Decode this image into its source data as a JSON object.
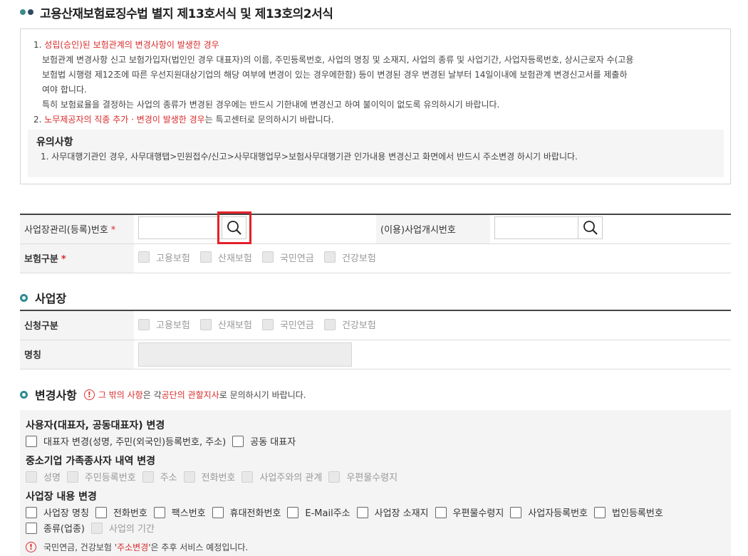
{
  "page": {
    "title": "고용산재보험료징수법 별지 제13호서식 및 제13호의2서식"
  },
  "notice": {
    "item1_num": "1.",
    "item1_head": "성립(승인)된 보험관계의 변경사항이 발생한 경우",
    "item1_line1": "보험관계 변경사항 신고 보험가입자(법인인 경우 대표자)의 이름, 주민등록번호, 사업의 명칭 및 소재지, 사업의 종류 및 사업기간, 사업자등록번호, 상시근로자 수(고용",
    "item1_line2": "보험법 시행령 제12조에 따른 우선지원대상기업의 해당 여부에 변경이 있는 경우에한함) 등이 변경된 경우 변경된 날부터 14일이내에 보험관계 변경신고서를 제출하",
    "item1_line3": "여야 합니다.",
    "item1_line4": "특히 보험료율을 결정하는 사업의 종류가 변경된 경우에는 반드시 기한내에 변경신고 하여 불이익이 없도록 유의하시기 바랍니다.",
    "item2_num": "2.",
    "item2_red": "노무제공자의 직종 추가 · 변경이 발생한 경우",
    "item2_rest": "는 특고센터로 문의하시기 바랍니다.",
    "caution_title": "유의사항",
    "caution_text": "1. 사무대행기관인 경우, 사무대행탭>민원접수/신고>사무대행업무>보험사무대행기관 인가내용 변경신고 화면에서 반드시 주소변경 하시기 바랍니다."
  },
  "form": {
    "reg_no_label": "사업장관리(등록)번호",
    "reg_no_required": "*",
    "reg_no_value": "",
    "start_no_label": "(이용)사업개시번호",
    "start_no_value": "",
    "insurance_label": "보험구분",
    "insurance_required": "*",
    "insurance_options": [
      "고용보험",
      "산재보험",
      "국민연금",
      "건강보험"
    ]
  },
  "workplace": {
    "section_title": "사업장",
    "apply_label": "신청구분",
    "apply_options": [
      "고용보험",
      "산재보험",
      "국민연금",
      "건강보험"
    ],
    "name_label": "명칭",
    "name_value": ""
  },
  "changes": {
    "section_title": "변경사항",
    "warn_icon": "!",
    "warn_red1": "그 밖의 사항",
    "warn_mid1": "은 각 ",
    "warn_red2": "공단의 관할지사",
    "warn_mid2": "로 문의하시기 바랍니다.",
    "group1_title": "사용자(대표자, 공동대표자) 변경",
    "group1_options": [
      "대표자 변경(성명, 주민(외국인)등록번호, 주소)",
      "공동 대표자"
    ],
    "group2_title": "중소기업 가족종사자 내역 변경",
    "group2_options": [
      "성명",
      "주민등록번호",
      "주소",
      "전화번호",
      "사업주와의 관계",
      "우편물수령지"
    ],
    "group3_title": "사업장 내용 변경",
    "group3_options": [
      "사업장 명칭",
      "전화번호",
      "팩스번호",
      "휴대전화번호",
      "E-Mail주소",
      "사업장 소재지",
      "우편물수령지",
      "사업자등록번호",
      "법인등록번호"
    ],
    "group3_options_row2": [
      "종류(업종)",
      "사업의 기간"
    ],
    "foot_pre": "국민연금, 건강보험 '",
    "foot_red": "주소변경",
    "foot_post": "'은 추후 서비스 예정입니다."
  }
}
